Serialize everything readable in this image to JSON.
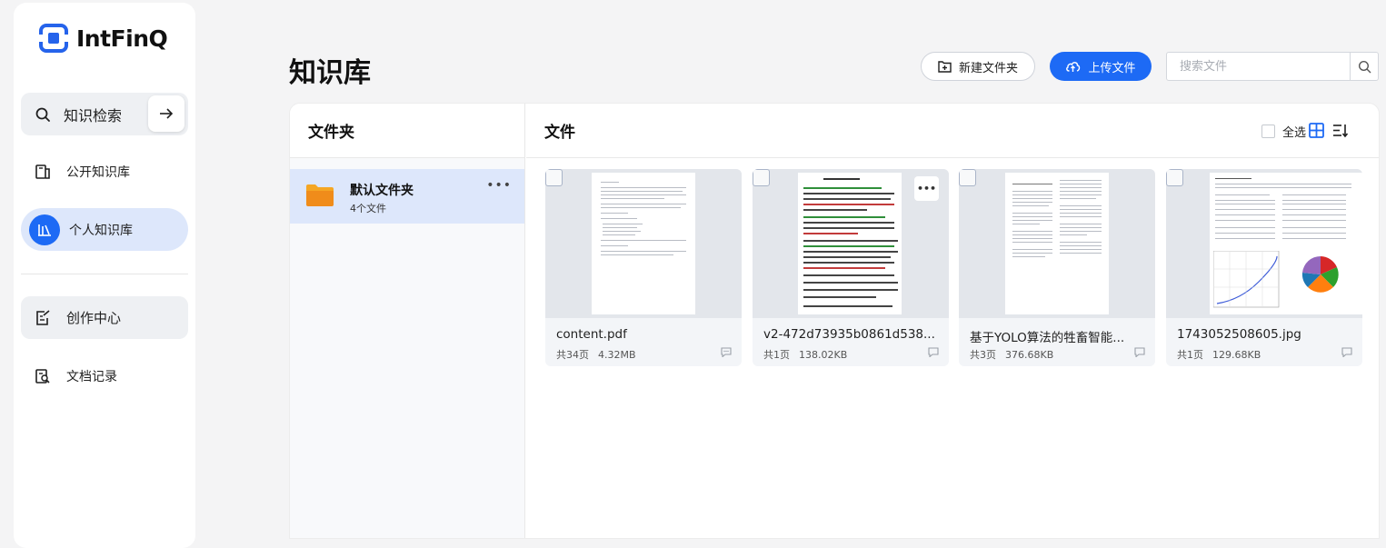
{
  "app": {
    "logo_text": "IntFinQ"
  },
  "sidebar": {
    "search": {
      "label": "知识检索",
      "icon": "search-icon"
    },
    "items": [
      {
        "label": "公开知识库",
        "icon": "book-icon"
      },
      {
        "label": "个人知识库",
        "icon": "bookshelf-icon",
        "active": true
      },
      {
        "label": "创作中心",
        "icon": "edit-doc-icon"
      },
      {
        "label": "文档记录",
        "icon": "doc-search-icon"
      }
    ]
  },
  "header": {
    "title": "知识库",
    "new_folder_label": "新建文件夹",
    "upload_label": "上传文件",
    "search_placeholder": "搜索文件"
  },
  "folders": {
    "title": "文件夹",
    "items": [
      {
        "name": "默认文件夹",
        "count": "4个文件"
      }
    ]
  },
  "files": {
    "title": "文件",
    "select_all_label": "全选",
    "items": [
      {
        "name": "content.pdf",
        "pages": "共34页",
        "size": "4.32MB"
      },
      {
        "name": "v2-472d73935b0861d538...",
        "pages": "共1页",
        "size": "138.02KB"
      },
      {
        "name": "基于YOLO算法的牲畜智能...",
        "pages": "共3页",
        "size": "376.68KB"
      },
      {
        "name": "1743052508605.jpg",
        "pages": "共1页",
        "size": "129.68KB"
      }
    ]
  },
  "colors": {
    "accent": "#1d6af5",
    "active_bg": "#dde7fb"
  }
}
